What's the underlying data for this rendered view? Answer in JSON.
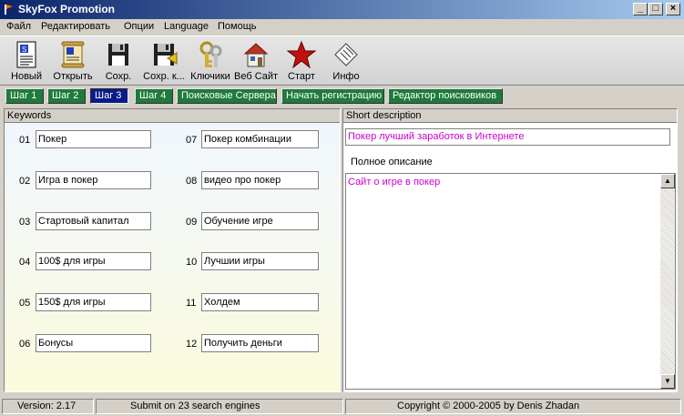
{
  "window": {
    "title": "SkyFox Promotion",
    "controls": {
      "minimize": "_",
      "maximize": "□",
      "close": "×"
    }
  },
  "menu": [
    "Файл",
    "Редактировать",
    "Опции",
    "Language",
    "Помощь"
  ],
  "toolbar": [
    {
      "label": "Новый",
      "icon": "new-document-icon"
    },
    {
      "label": "Открыть",
      "icon": "open-scroll-icon"
    },
    {
      "label": "Сохр.",
      "icon": "save-floppy-icon"
    },
    {
      "label": "Сохр. к...",
      "icon": "save-as-floppy-icon"
    },
    {
      "label": "Ключики",
      "icon": "keys-icon"
    },
    {
      "label": "Веб Сайт",
      "icon": "home-icon"
    },
    {
      "label": "Старт",
      "icon": "star-icon"
    },
    {
      "label": "Инфо",
      "icon": "info-icon"
    }
  ],
  "tabs": [
    {
      "label": "Шаг 1"
    },
    {
      "label": "Шаг 2"
    },
    {
      "label": "Шаг 3",
      "active": true
    },
    {
      "label": "Шаг 4"
    },
    {
      "label": "Поисковые Сервера"
    },
    {
      "label": "Начать регистрацию"
    },
    {
      "label": "Редактор поисковиков"
    }
  ],
  "keywords": {
    "header": "Keywords",
    "items": [
      {
        "num": "01",
        "value": "Покер"
      },
      {
        "num": "02",
        "value": "Игра в покер"
      },
      {
        "num": "03",
        "value": "Стартовый капитал"
      },
      {
        "num": "04",
        "value": "100$ для игры"
      },
      {
        "num": "05",
        "value": "150$ для игры"
      },
      {
        "num": "06",
        "value": "Бонусы"
      },
      {
        "num": "07",
        "value": "Покер комбинации"
      },
      {
        "num": "08",
        "value": "видео про покер"
      },
      {
        "num": "09",
        "value": "Обучение игре"
      },
      {
        "num": "10",
        "value": "Лучшии игры"
      },
      {
        "num": "11",
        "value": "Холдем"
      },
      {
        "num": "12",
        "value": "Получить деньги"
      }
    ]
  },
  "description": {
    "header": "Short description",
    "short_value": "Покер лучший заработок в Интернете",
    "full_label": "Полное описание",
    "full_value": "Сайт о игре в покер"
  },
  "status": {
    "version": "Version: 2.17",
    "submit": "Submit on 23 search engines",
    "copyright": "Copyright © 2000-2005 by Denis Zhadan"
  },
  "colors": {
    "tab": "#1f7a3c",
    "tab_active": "#0a1a8a",
    "description_text": "#cc00cc",
    "title_gradient_start": "#0a246a"
  }
}
